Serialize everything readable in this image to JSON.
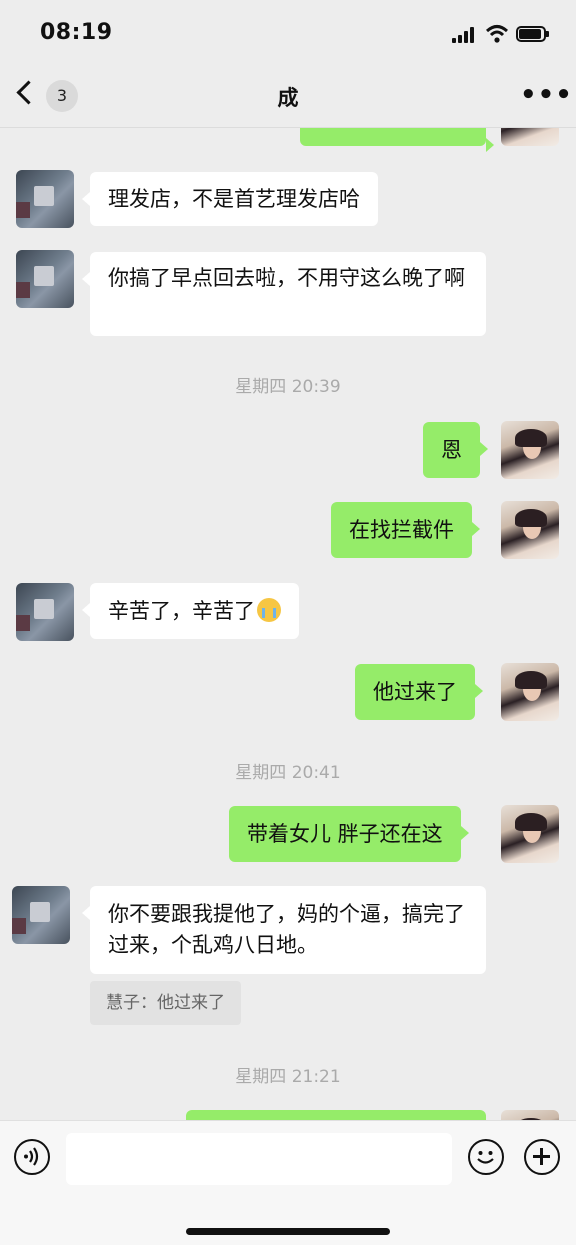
{
  "status_bar": {
    "time": "08:19"
  },
  "nav": {
    "unread_count": "3",
    "title": "成",
    "more_label": "•••"
  },
  "messages": [
    {
      "side": "in",
      "text": "理发店，不是首艺理发店哈"
    },
    {
      "side": "in",
      "text": "你搞了早点回去啦，不用守这么晚了啊"
    },
    {
      "side": "out",
      "text": "恩"
    },
    {
      "side": "out",
      "text": "在找拦截件"
    },
    {
      "side": "in",
      "text": "辛苦了，辛苦了"
    },
    {
      "side": "out",
      "text": "他过来了"
    },
    {
      "side": "out",
      "text": "带着女儿 胖子还在这"
    },
    {
      "side": "in",
      "text": "你不要跟我提他了，妈的个逼，搞完了过来，个乱鸡八日地。"
    }
  ],
  "timestamps": [
    "星期四 20:39",
    "星期四 20:41",
    "星期四 21:21"
  ],
  "quote": "慧子：他过来了",
  "input": {
    "placeholder": ""
  },
  "icons": {
    "back": "chevron-left-icon",
    "more": "more-dots-icon",
    "voice": "voice-icon",
    "emoji": "smiley-icon",
    "plus": "plus-icon",
    "emoji_in_message": "crying-emoji-icon"
  },
  "colors": {
    "outgoing_bubble": "#95ec69",
    "incoming_bubble": "#ffffff",
    "background": "#ededed"
  }
}
